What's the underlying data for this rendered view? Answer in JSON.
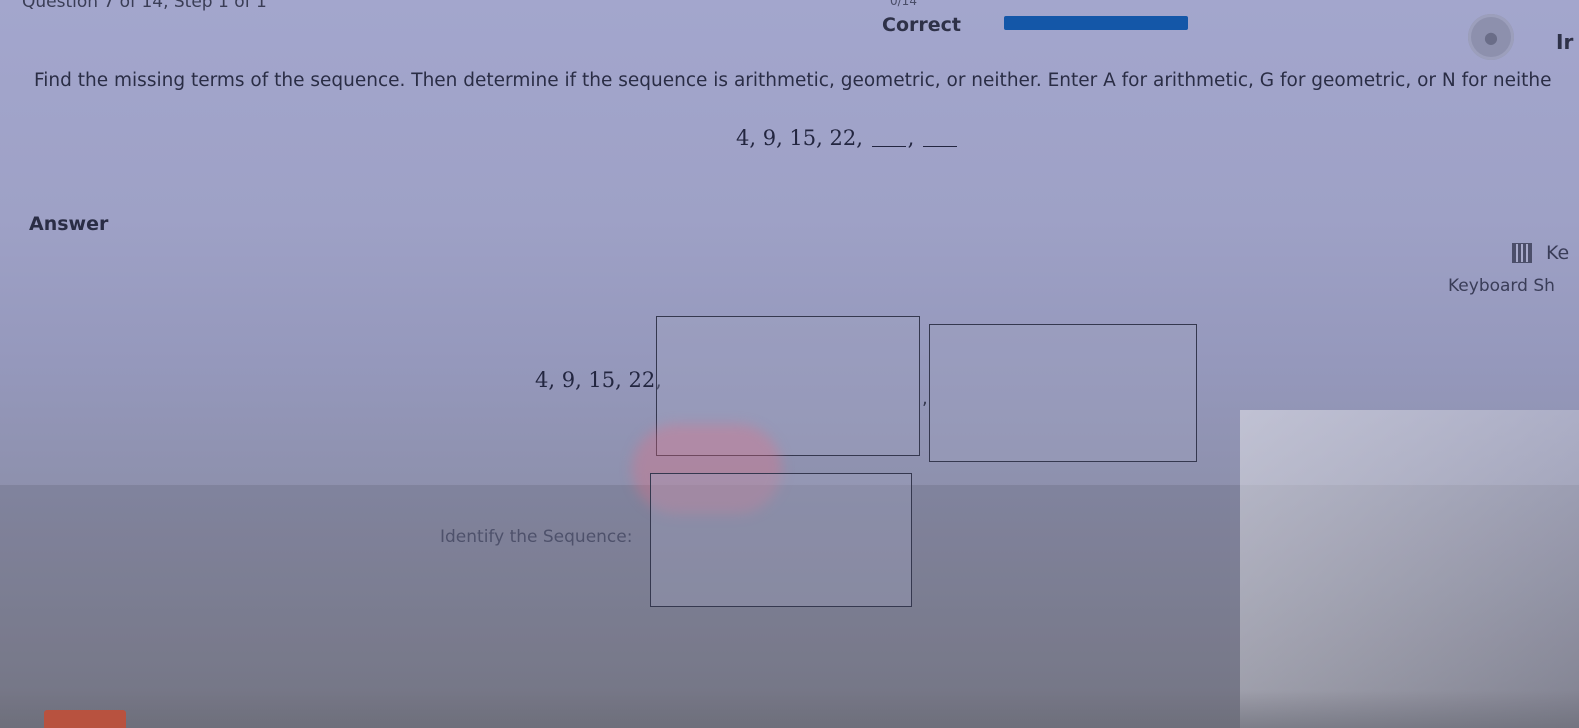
{
  "header": {
    "question_label": "Question 7 of 14, Step 1 of 1",
    "score": "0/14",
    "status": "Correct",
    "progress_fraction": 1.0,
    "corner_text": "Ir"
  },
  "question": {
    "instructions": "Find the missing terms of the sequence. Then determine if the sequence is arithmetic, geometric, or neither. Enter A for arithmetic, G for geometric, or N for neithe",
    "sequence": "4, 9, 15, 22,",
    "separator": ","
  },
  "answer": {
    "label": "Answer",
    "sequence_prefix": "4, 9, 15, 22,",
    "box_separator": ",",
    "term1_value": "",
    "term2_value": "",
    "identify_label": "Identify the Sequence:",
    "identify_value": ""
  },
  "tools": {
    "keypad_label": "Ke",
    "keyboard_shortcuts_label": "Keyboard Sh"
  },
  "colors": {
    "progress": "#1457a8",
    "bottom_button": "#b8523f"
  },
  "icons": {
    "badge": "points-badge-icon",
    "keypad": "calculator-icon"
  }
}
